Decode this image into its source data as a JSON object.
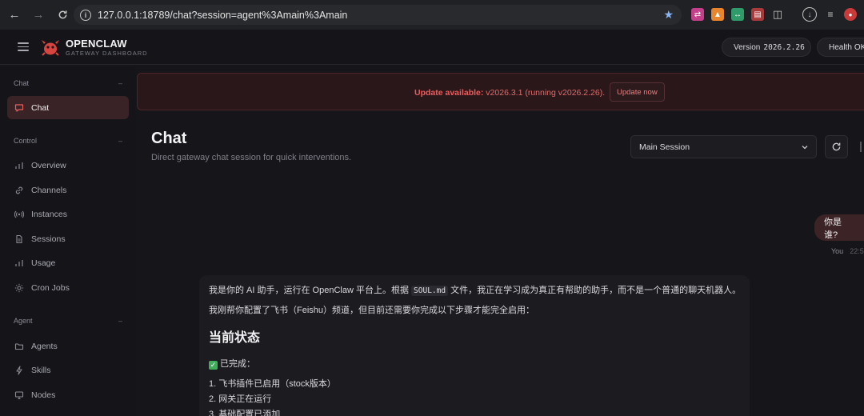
{
  "browser": {
    "url": "127.0.0.1:18789/chat?session=agent%3Amain%3Amain"
  },
  "header": {
    "brand_title": "OPENCLAW",
    "brand_subtitle": "GATEWAY DASHBOARD",
    "version_label": "Version",
    "version_value": "2026.2.26",
    "health_label": "Health",
    "health_value": "OK"
  },
  "sidebar": {
    "sections": [
      {
        "label": "Chat",
        "collapse": "–"
      },
      {
        "label": "Control",
        "collapse": "–"
      },
      {
        "label": "Agent",
        "collapse": "–"
      }
    ],
    "items": [
      {
        "label": "Chat",
        "icon": "chat-bubble-icon"
      },
      {
        "label": "Overview",
        "icon": "bar-chart-icon"
      },
      {
        "label": "Channels",
        "icon": "link-icon"
      },
      {
        "label": "Instances",
        "icon": "broadcast-icon"
      },
      {
        "label": "Sessions",
        "icon": "document-icon"
      },
      {
        "label": "Usage",
        "icon": "bar-chart-icon"
      },
      {
        "label": "Cron Jobs",
        "icon": "sun-icon"
      },
      {
        "label": "Agents",
        "icon": "folder-icon"
      },
      {
        "label": "Skills",
        "icon": "bolt-icon"
      },
      {
        "label": "Nodes",
        "icon": "monitor-icon"
      }
    ]
  },
  "banner": {
    "prefix": "Update available:",
    "version": "v2026.3.1 (running v2026.2.26).",
    "button_label": "Update now"
  },
  "page": {
    "title": "Chat",
    "subtitle": "Direct gateway chat session for quick interventions.",
    "session_selected": "Main Session"
  },
  "chat": {
    "user_message": "你是谁?",
    "user_sender": "You",
    "user_time": "22:5",
    "ai_line1_before": "我是你的 AI 助手，运行在 OpenClaw 平台上。根据",
    "ai_line1_code": "SOUL.md",
    "ai_line1_after": "文件，我正在学习成为真正有帮助的助手，而不是一个普通的聊天机器人。",
    "ai_line2": "我刚帮你配置了飞书（Feishu）频道，但目前还需要你完成以下步骤才能完全启用：",
    "ai_heading": "当前状态",
    "ai_done_label": "已完成：",
    "ai_list": [
      "1. 飞书插件已启用（stock版本）",
      "2. 网关正在运行",
      "3. 基础配置已添加"
    ]
  },
  "colors": {
    "accent": "#e85d5d",
    "active_bg": "#3a2326",
    "version_dot": "#f0a63a",
    "health_dot": "#3fc46a"
  }
}
